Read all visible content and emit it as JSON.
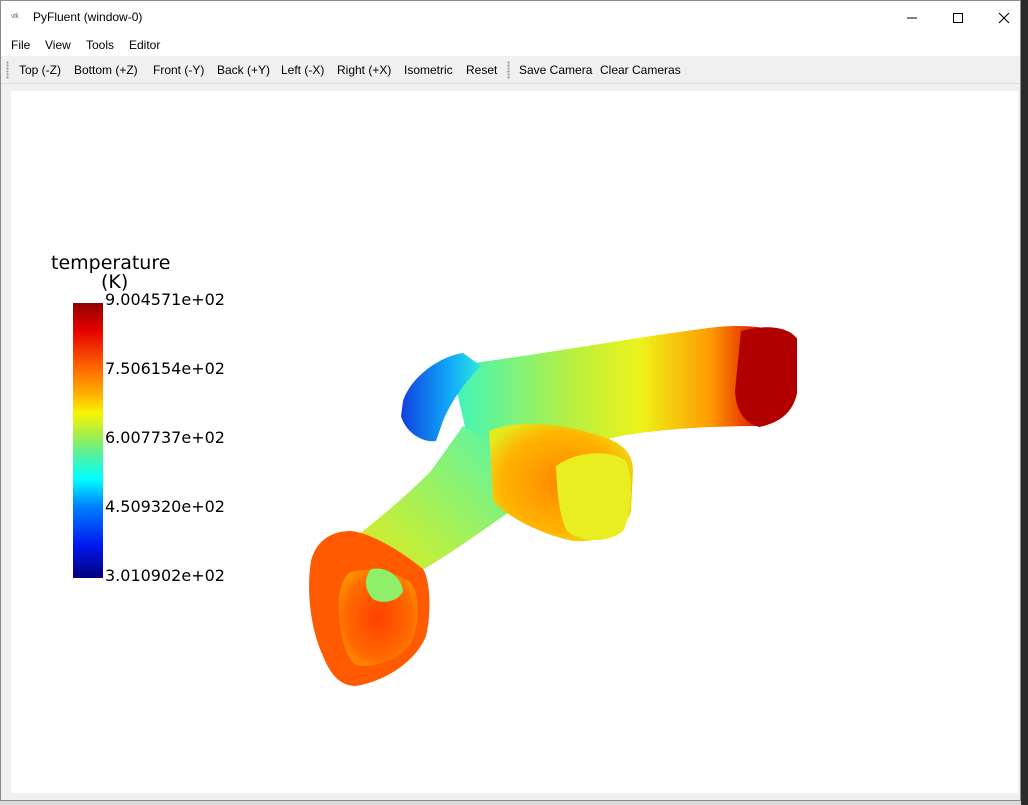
{
  "window": {
    "title": "PyFluent (window-0)",
    "icon_text": "vtk"
  },
  "menu": [
    "File",
    "View",
    "Tools",
    "Editor"
  ],
  "toolbar": {
    "views": [
      "Top (-Z)",
      "Bottom (+Z)",
      "Front (-Y)",
      "Back (+Y)",
      "Left (-X)",
      "Right (+X)",
      "Isometric",
      "Reset"
    ],
    "camera": [
      "Save Camera",
      "Clear Cameras"
    ]
  },
  "legend": {
    "title_line1": "temperature",
    "title_line2": "(K)",
    "labels": [
      "9.004571e+02",
      "7.506154e+02",
      "6.007737e+02",
      "4.509320e+02",
      "3.010902e+02"
    ],
    "max": 900.4571,
    "min": 301.0902
  },
  "colors": {
    "hot": "#a80000",
    "warm": "#ff5a00",
    "mid": "#c8f032",
    "cool": "#3cf5c0",
    "cold": "#1e6cf0"
  }
}
